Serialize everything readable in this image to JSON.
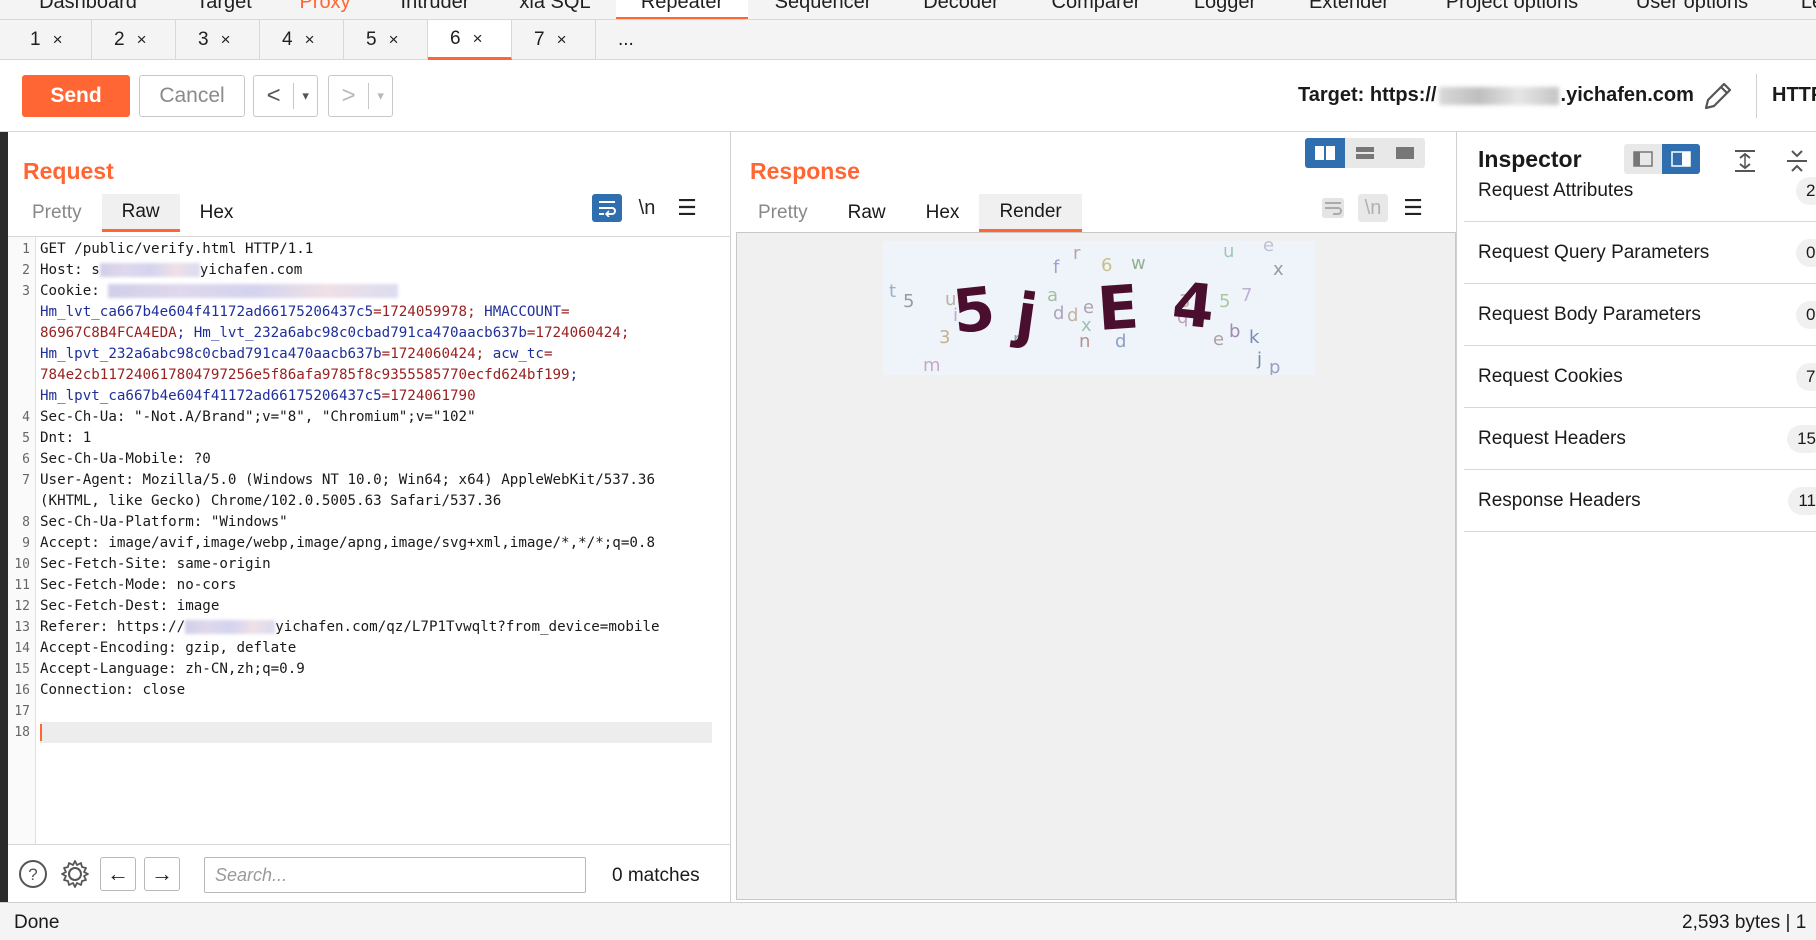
{
  "main_tabs": [
    {
      "label": "Dashboard"
    },
    {
      "label": "Target"
    },
    {
      "label": "Proxy"
    },
    {
      "label": "Intruder"
    },
    {
      "label": "xia SQL"
    },
    {
      "label": "Repeater"
    },
    {
      "label": "Sequencer"
    },
    {
      "label": "Decoder"
    },
    {
      "label": "Comparer"
    },
    {
      "label": "Logger"
    },
    {
      "label": "Extender"
    },
    {
      "label": "Project options"
    },
    {
      "label": "User options"
    },
    {
      "label": "Le"
    }
  ],
  "sub_tabs": [
    {
      "label": "1",
      "close": "×"
    },
    {
      "label": "2",
      "close": "×"
    },
    {
      "label": "3",
      "close": "×"
    },
    {
      "label": "4",
      "close": "×"
    },
    {
      "label": "5",
      "close": "×"
    },
    {
      "label": "6",
      "close": "×"
    },
    {
      "label": "7",
      "close": "×"
    },
    {
      "label": "...",
      "close": ""
    }
  ],
  "toolbar": {
    "send_label": "Send",
    "cancel_label": "Cancel",
    "back_glyph": "<",
    "forward_glyph": ">",
    "drop_glyph": "▾",
    "target_prefix": "Target: https://",
    "target_suffix": ".yichafen.com",
    "http_label": "HTTP"
  },
  "request": {
    "title": "Request",
    "tabs": [
      "Pretty",
      "Raw",
      "Hex"
    ],
    "active_tab": "Raw",
    "newline_label": "\\n",
    "lines": [
      {
        "n": "1",
        "text": "GET /public/verify.html HTTP/1.1"
      },
      {
        "n": "2",
        "text_a": "Host: s",
        "text_b": "yichafen.com"
      },
      {
        "n": "3",
        "text": "Cookie: "
      },
      {
        "n": "",
        "key": "Hm_lvt_ca667b4e604f41172ad66175206437c5",
        "val": "=1724059978; ",
        "key2": "HMACCOUNT",
        "val2": "="
      },
      {
        "n": "",
        "val": "86967C8B4FCA4EDA",
        "key": "; Hm_lvt_232a6abc98c0cbad791ca470aacb637b",
        "val2": "=1724060424;"
      },
      {
        "n": "",
        "key": "Hm_lpvt_232a6abc98c0cbad791ca470aacb637b",
        "val": "=1724060424; ",
        "key2": "acw_tc",
        "val2": "="
      },
      {
        "n": "",
        "val": "784e2cb117240617804797256e5f86afa9785f8c9355585770ecfd624bf199",
        "key": ";"
      },
      {
        "n": "",
        "key": "Hm_lpvt_ca667b4e604f41172ad66175206437c5",
        "val": "=1724061790"
      },
      {
        "n": "4",
        "text": "Sec-Ch-Ua: \"-Not.A/Brand\";v=\"8\", \"Chromium\";v=\"102\""
      },
      {
        "n": "5",
        "text": "Dnt: 1"
      },
      {
        "n": "6",
        "text": "Sec-Ch-Ua-Mobile: ?0"
      },
      {
        "n": "7",
        "text": "User-Agent: Mozilla/5.0 (Windows NT 10.0; Win64; x64) AppleWebKit/537.36"
      },
      {
        "n": "",
        "text": "(KHTML, like Gecko) Chrome/102.0.5005.63 Safari/537.36"
      },
      {
        "n": "8",
        "text": "Sec-Ch-Ua-Platform: \"Windows\""
      },
      {
        "n": "9",
        "text": "Accept: image/avif,image/webp,image/apng,image/svg+xml,image/*,*/*;q=0.8"
      },
      {
        "n": "10",
        "text": "Sec-Fetch-Site: same-origin"
      },
      {
        "n": "11",
        "text": "Sec-Fetch-Mode: no-cors"
      },
      {
        "n": "12",
        "text": "Sec-Fetch-Dest: image"
      },
      {
        "n": "13",
        "text_a": "Referer: https://",
        "text_b": "yichafen.com/qz/L7P1Tvwqlt?from_device=mobile"
      },
      {
        "n": "14",
        "text": "Accept-Encoding: gzip, deflate"
      },
      {
        "n": "15",
        "text": "Accept-Language: zh-CN,zh;q=0.9"
      },
      {
        "n": "16",
        "text": "Connection: close"
      },
      {
        "n": "17",
        "text": ""
      },
      {
        "n": "18",
        "text": ""
      }
    ],
    "search_placeholder": "Search...",
    "matches": "0 matches"
  },
  "response": {
    "title": "Response",
    "tabs": [
      "Pretty",
      "Raw",
      "Hex",
      "Render"
    ],
    "active_tab": "Render",
    "newline_label": "\\n",
    "captcha_text": "5 j E 4"
  },
  "inspector": {
    "title": "Inspector",
    "rows": [
      {
        "label": "Request Attributes",
        "count": "2"
      },
      {
        "label": "Request Query Parameters",
        "count": "0"
      },
      {
        "label": "Request Body Parameters",
        "count": "0"
      },
      {
        "label": "Request Cookies",
        "count": "7"
      },
      {
        "label": "Request Headers",
        "count": "15"
      },
      {
        "label": "Response Headers",
        "count": "11"
      }
    ]
  },
  "status": {
    "left": "Done",
    "right": "2,593 bytes | 1"
  },
  "colors": {
    "accent": "#ff6633",
    "selected_blue": "#2f6fb0"
  }
}
